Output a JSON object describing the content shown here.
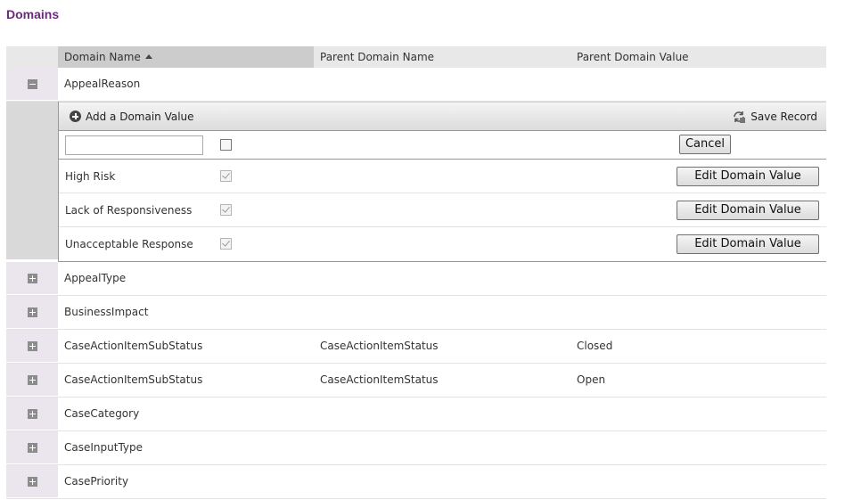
{
  "page": {
    "title": "Domains"
  },
  "columns": {
    "domain_name": "Domain Name",
    "parent_domain_name": "Parent Domain Name",
    "parent_domain_value": "Parent Domain Value"
  },
  "expanded_row": {
    "name": "AppealReason",
    "toolbar": {
      "add_label": "Add a Domain Value",
      "save_label": "Save Record"
    },
    "new_value": {
      "value": "",
      "cancel_label": "Cancel"
    },
    "values": [
      {
        "name": "High Risk",
        "checked": true,
        "edit_label": "Edit Domain Value"
      },
      {
        "name": "Lack of Responsiveness",
        "checked": true,
        "edit_label": "Edit Domain Value"
      },
      {
        "name": "Unacceptable Response",
        "checked": true,
        "edit_label": "Edit Domain Value"
      }
    ]
  },
  "rows": [
    {
      "name": "AppealType",
      "parent_name": "",
      "parent_value": ""
    },
    {
      "name": "BusinessImpact",
      "parent_name": "",
      "parent_value": ""
    },
    {
      "name": "CaseActionItemSubStatus",
      "parent_name": "CaseActionItemStatus",
      "parent_value": "Closed"
    },
    {
      "name": "CaseActionItemSubStatus",
      "parent_name": "CaseActionItemStatus",
      "parent_value": "Open"
    },
    {
      "name": "CaseCategory",
      "parent_name": "",
      "parent_value": ""
    },
    {
      "name": "CaseInputType",
      "parent_name": "",
      "parent_value": ""
    },
    {
      "name": "CasePriority",
      "parent_name": "",
      "parent_value": ""
    }
  ],
  "colors": {
    "title": "#6b2a7d",
    "expander_bg": "#ebe6ee",
    "header_bg": "#e8e8e8",
    "sorted_header_bg": "#cccccc"
  }
}
